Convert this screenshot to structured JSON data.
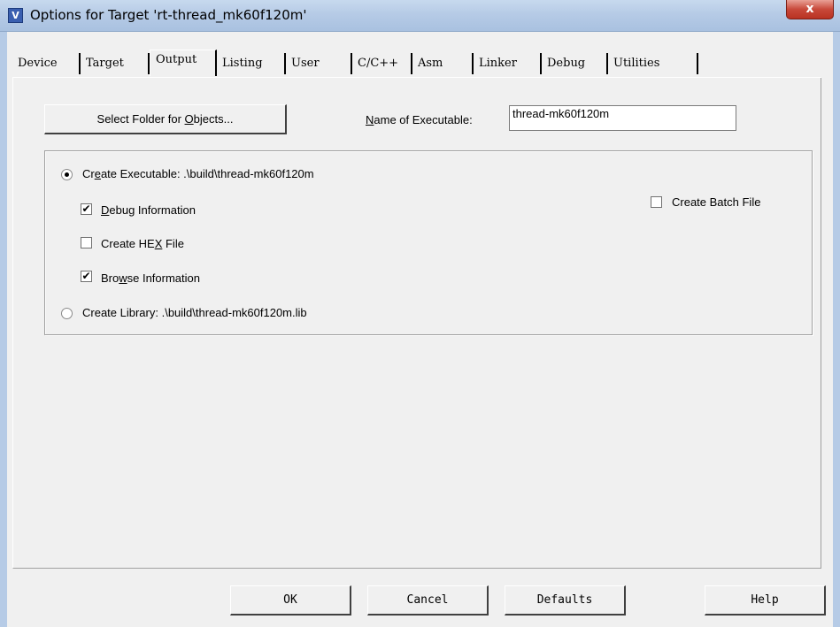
{
  "window": {
    "title": "Options for Target 'rt-thread_mk60f120m'",
    "app_icon": "keil-uvision-icon",
    "close_glyph": "x"
  },
  "tabs": [
    {
      "label": "Device",
      "active": false
    },
    {
      "label": "Target",
      "active": false
    },
    {
      "label": "Output",
      "active": true
    },
    {
      "label": "Listing",
      "active": false
    },
    {
      "label": "User",
      "active": false
    },
    {
      "label": "C/C++",
      "active": false
    },
    {
      "label": "Asm",
      "active": false
    },
    {
      "label": "Linker",
      "active": false
    },
    {
      "label": "Debug",
      "active": false
    },
    {
      "label": "Utilities",
      "active": false
    }
  ],
  "output": {
    "select_folder": {
      "before": "Select Folder for ",
      "mnemonic": "O",
      "after": "bjects..."
    },
    "name_label": {
      "mnemonic": "N",
      "after": "ame of Executable:"
    },
    "name_value": "thread-mk60f120m",
    "create_executable": {
      "before": "Cr",
      "mnemonic": "e",
      "after": "ate Executable:  .\\build\\thread-mk60f120m",
      "selected": true
    },
    "debug_information": {
      "mnemonic": "D",
      "after": "ebug Information",
      "checked": true
    },
    "create_hex": {
      "before": "Create HE",
      "mnemonic": "X",
      "after": " File",
      "checked": false
    },
    "browse_information": {
      "before": "Bro",
      "mnemonic": "w",
      "after": "se Information",
      "checked": true
    },
    "create_library": {
      "text": "Create Library:  .\\build\\thread-mk60f120m.lib",
      "selected": false
    },
    "create_batch_file": {
      "text": "Create Batch File",
      "checked": false
    }
  },
  "buttons": {
    "ok": "OK",
    "cancel": "Cancel",
    "defaults": "Defaults",
    "help": "Help"
  },
  "check_glyph": "✔"
}
